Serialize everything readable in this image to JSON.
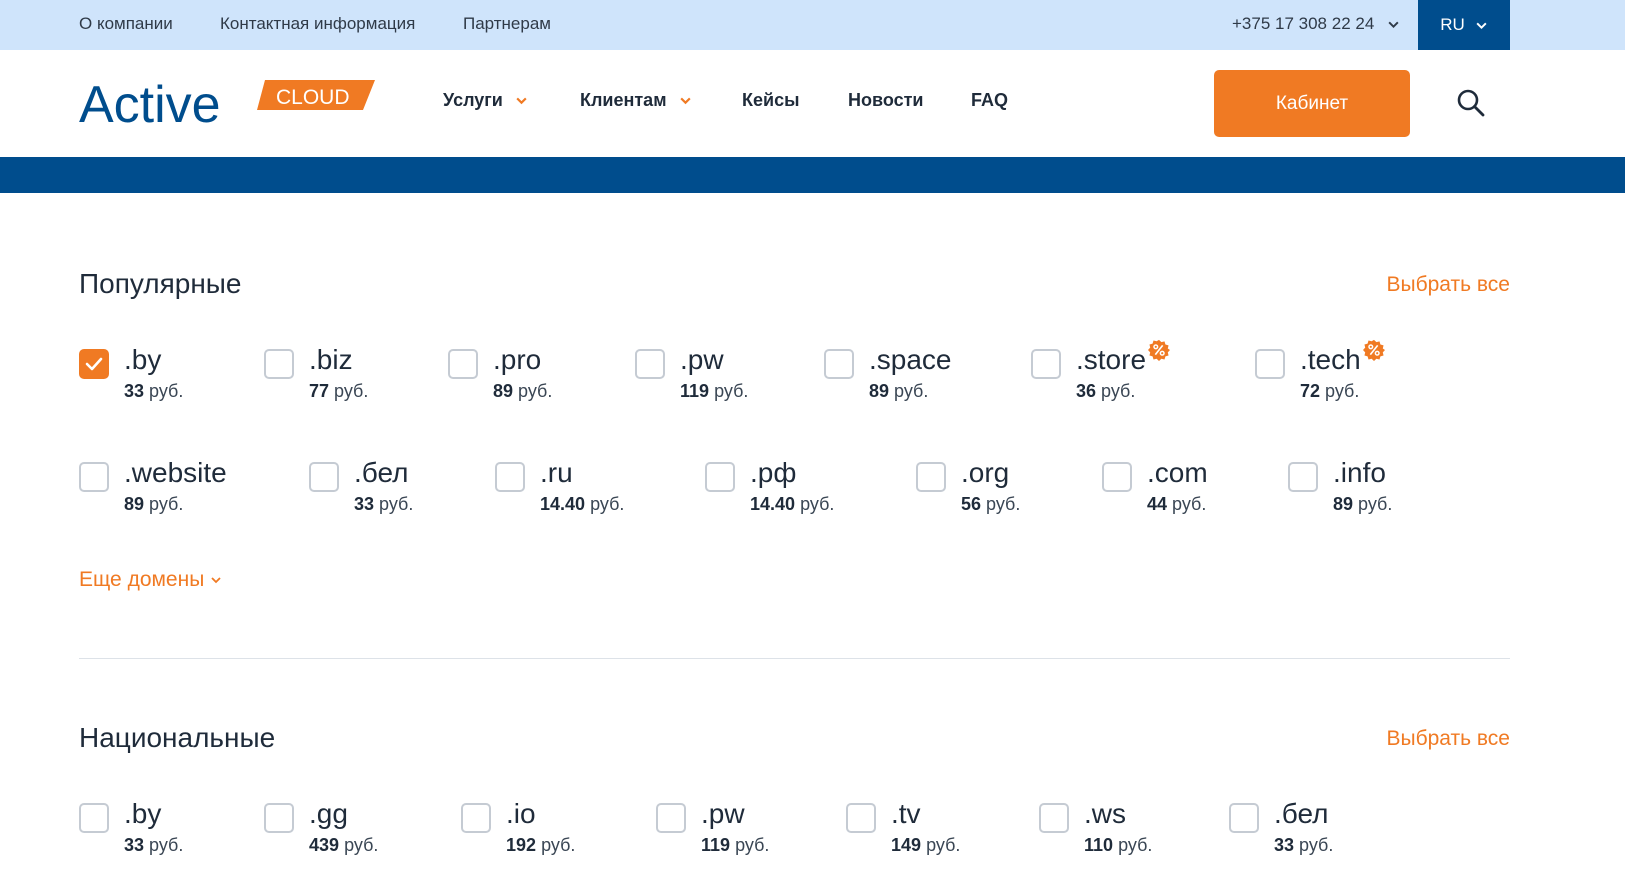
{
  "topbar": {
    "links": [
      "О компании",
      "Контактная информация",
      "Партнерам"
    ],
    "phone": "+375 17 308 22 24",
    "lang": "RU"
  },
  "header": {
    "logo_text": "Active",
    "logo_badge": "CLOUD",
    "nav": [
      "Услуги",
      "Клиентам",
      "Кейсы",
      "Новости",
      "FAQ"
    ],
    "cabinet_label": "Кабинет"
  },
  "colors": {
    "accent": "#f07a23",
    "brand_blue": "#004d8d",
    "topbar_bg": "#cfe4fb"
  },
  "popular": {
    "title": "Популярные",
    "select_all": "Выбрать все",
    "currency": "руб.",
    "row1": [
      {
        "name": ".by",
        "price": "33",
        "checked": true,
        "discount": false
      },
      {
        "name": ".biz",
        "price": "77",
        "checked": false,
        "discount": false
      },
      {
        "name": ".pro",
        "price": "89",
        "checked": false,
        "discount": false
      },
      {
        "name": ".pw",
        "price": "119",
        "checked": false,
        "discount": false
      },
      {
        "name": ".space",
        "price": "89",
        "checked": false,
        "discount": false
      },
      {
        "name": ".store",
        "price": "36",
        "checked": false,
        "discount": true
      },
      {
        "name": ".tech",
        "price": "72",
        "checked": false,
        "discount": true
      }
    ],
    "row2": [
      {
        "name": ".website",
        "price": "89",
        "checked": false,
        "discount": false
      },
      {
        "name": ".бел",
        "price": "33",
        "checked": false,
        "discount": false
      },
      {
        "name": ".ru",
        "price": "14.40",
        "checked": false,
        "discount": false
      },
      {
        "name": ".рф",
        "price": "14.40",
        "checked": false,
        "discount": false
      },
      {
        "name": ".org",
        "price": "56",
        "checked": false,
        "discount": false
      },
      {
        "name": ".com",
        "price": "44",
        "checked": false,
        "discount": false
      },
      {
        "name": ".info",
        "price": "89",
        "checked": false,
        "discount": false
      }
    ],
    "more_label": "Еще домены"
  },
  "national": {
    "title": "Национальные",
    "select_all": "Выбрать все",
    "currency": "руб.",
    "row1": [
      {
        "name": ".by",
        "price": "33",
        "checked": false,
        "discount": false
      },
      {
        "name": ".gg",
        "price": "439",
        "checked": false,
        "discount": false
      },
      {
        "name": ".io",
        "price": "192",
        "checked": false,
        "discount": false
      },
      {
        "name": ".pw",
        "price": "119",
        "checked": false,
        "discount": false
      },
      {
        "name": ".tv",
        "price": "149",
        "checked": false,
        "discount": false
      },
      {
        "name": ".ws",
        "price": "110",
        "checked": false,
        "discount": false
      },
      {
        "name": ".бел",
        "price": "33",
        "checked": false,
        "discount": false
      }
    ]
  }
}
